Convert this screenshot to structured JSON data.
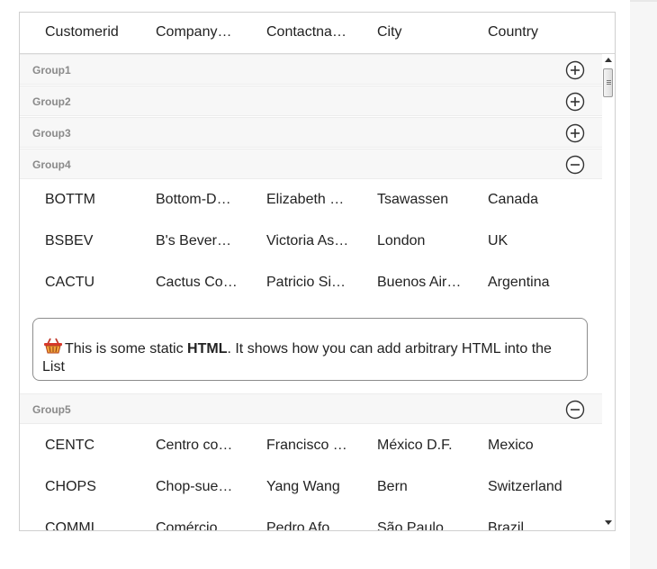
{
  "columns": [
    "Customerid",
    "Companyn…",
    "Contactna…",
    "City",
    "Country"
  ],
  "groups": [
    {
      "label": "Group1",
      "expanded": false,
      "icon": "plus-icon"
    },
    {
      "label": "Group2",
      "expanded": false,
      "icon": "plus-icon"
    },
    {
      "label": "Group3",
      "expanded": false,
      "icon": "plus-icon"
    },
    {
      "label": "Group4",
      "expanded": true,
      "icon": "minus-icon"
    },
    {
      "label": "Group5",
      "expanded": true,
      "icon": "minus-icon"
    }
  ],
  "group4_rows": [
    [
      "BOTTM",
      "Bottom-Do…",
      "Elizabeth …",
      "Tsawassen",
      "Canada"
    ],
    [
      "BSBEV",
      "B's Bevera…",
      "Victoria As…",
      "London",
      "UK"
    ],
    [
      "CACTU",
      "Cactus Co…",
      "Patricio Si…",
      "Buenos Air…",
      "Argentina"
    ]
  ],
  "static_html": {
    "icon": "basket-icon",
    "text_before": "This is some static ",
    "bold": "HTML",
    "text_after": ". It shows how you can add arbitrary HTML into the List"
  },
  "group5_rows": [
    [
      "CENTC",
      "Centro co…",
      "Francisco …",
      "México D.F.",
      "Mexico"
    ],
    [
      "CHOPS",
      "Chop-suey…",
      "Yang Wang",
      "Bern",
      "Switzerland"
    ],
    [
      "COMMI",
      "Comércio…",
      "Pedro Afo…",
      "São Paulo",
      "Brazil"
    ]
  ],
  "colors": {
    "group_label": "#8a8a8a",
    "group_bg": "#f7f7f7",
    "border": "#cfcfcf"
  }
}
